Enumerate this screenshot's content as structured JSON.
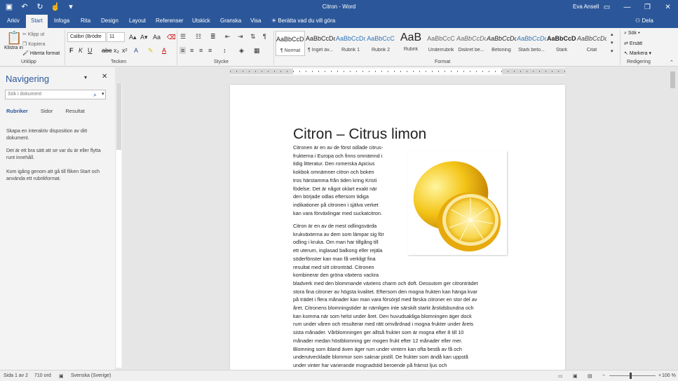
{
  "window": {
    "title": "Citron - Word",
    "user": "Eva Ansell"
  },
  "tabs": [
    "Arkiv",
    "Start",
    "Infoga",
    "Rita",
    "Design",
    "Layout",
    "Referenser",
    "Utskick",
    "Granska",
    "Visa"
  ],
  "tell_me": "Berätta vad du vill göra",
  "share": "Dela",
  "clipboard": {
    "paste": "Klistra in",
    "cut": "Klipp ut",
    "copy": "Kopiera",
    "format_painter": "Hämta format",
    "label": "Urklipp"
  },
  "font": {
    "name": "Calibri (Brödte",
    "size": "11",
    "label": "Tecken"
  },
  "paragraph": {
    "label": "Stycke"
  },
  "styles": {
    "label": "Format",
    "items": [
      {
        "sample": "AaBbCcDc",
        "name": "¶ Normal"
      },
      {
        "sample": "AaBbCcDc",
        "name": "¶ Inget av..."
      },
      {
        "sample": "AaBbCcDc",
        "name": "Rubrik 1"
      },
      {
        "sample": "AaBbCcC",
        "name": "Rubrik 2"
      },
      {
        "sample": "AaB",
        "name": "Rubrik"
      },
      {
        "sample": "AaBbCcC",
        "name": "Underrubrik"
      },
      {
        "sample": "AaBbCcDc",
        "name": "Diskret be..."
      },
      {
        "sample": "AaBbCcDc",
        "name": "Betoning"
      },
      {
        "sample": "AaBbCcDc",
        "name": "Stark beto..."
      },
      {
        "sample": "AaBbCcDc",
        "name": "Stark"
      },
      {
        "sample": "AaBbCcDc",
        "name": "Citat"
      }
    ]
  },
  "editing": {
    "find": "Sök",
    "replace": "Ersätt",
    "select": "Markera",
    "label": "Redigering"
  },
  "nav": {
    "title": "Navigering",
    "search_placeholder": "Sök i dokument",
    "tabs": [
      "Rubriker",
      "Sidor",
      "Resultat"
    ],
    "help1": "Skapa en interaktiv disposition av ditt dokument.",
    "help2": "Det är ett bra sätt att se var du är eller flytta runt innehåll.",
    "help3": "Kom igång genom att gå till fliken Start och använda ett rubrikformat."
  },
  "document": {
    "title": "Citron – Citrus limon",
    "p1": [
      "Citronen är en av de först odlade citrus-",
      "frukterna i Europa och finns omnämnd i",
      "tidig litteratur. Den romerska Apicius",
      "kokbok omnämner citron och boken",
      "tros härstamma från tiden kring Kristi",
      "födelse. Det är något oklart exakt när",
      "den började odlas eftersom tidiga",
      "indikationer på citronen i själva verket",
      "kan vara förväxlingar med suckatcitron."
    ],
    "p2": [
      "Citron är en av de mest odlingsvärda",
      "krukväxterna av dem som lämpar sig för",
      "odling i kruka. Om man har tillgång till",
      "ett uterum, inglasad balkong eller rejäla",
      "söderfönster kan man få verkligt fina",
      "resultat med sitt citronträd. Citronen",
      "kombinerar den gröna växtens vackra",
      "bladverk med den blommande växtens charm och doft. Dessutom ger citronträdet",
      "stora fina citroner av högsta kvalitet. Eftersom den mogna frukten kan hänga kvar",
      "på trädet i flera månader kan man vara försörjd med färska citroner en stor del av",
      "året. Citronens blomningstider är nämligen inte särskilt starkt årstidsbundna och",
      "kan komma när som helst under året. Den huvudsakliga blomningen äger dock",
      "rum under våren och resulterar med rätt omvårdnad i mogna frukter under årets",
      "sista månader. Vårblomningen ger alltså frukter som är mogna efter 8 till 10",
      "månader medan höstblomning ger mogen frukt efter 12 månader eller mer.",
      "Blomning som ibland även äger rum under vintern kan ofta bestå av få och",
      "underutvecklade blommor som saknar pistill. De frukter som ändå kan uppstå",
      "under vinter har varierande mognadstid beroende på främst ljus och"
    ]
  },
  "status": {
    "page": "Sida 1 av 2",
    "words": "710 ord",
    "language": "Svenska (Sverige)",
    "zoom": "100 %"
  },
  "colors": {
    "accent": "#2b579a"
  }
}
